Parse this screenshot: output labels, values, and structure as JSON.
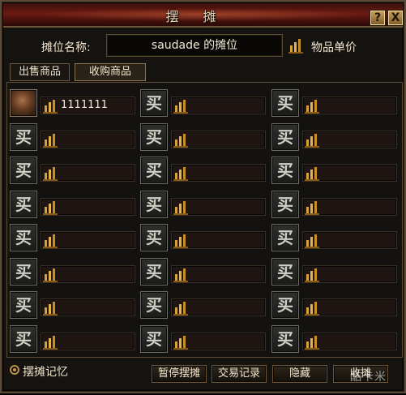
{
  "window": {
    "title": "摆摊",
    "help_symbol": "?",
    "close_symbol": "X"
  },
  "stall": {
    "name_label": "摊位名称:",
    "name_value": "saudade 的摊位",
    "unit_label": "物品单价",
    "unit_icon": "gold-bars-icon"
  },
  "tabs": [
    {
      "label": "出售商品",
      "active": false
    },
    {
      "label": "收购商品",
      "active": true
    }
  ],
  "slots": [
    {
      "icon": "item-icon",
      "price": "1111111"
    },
    {
      "icon": "buy-icon",
      "glyph": "买",
      "price": ""
    },
    {
      "icon": "buy-icon",
      "glyph": "买",
      "price": ""
    },
    {
      "icon": "buy-icon",
      "glyph": "买",
      "price": ""
    },
    {
      "icon": "buy-icon",
      "glyph": "买",
      "price": ""
    },
    {
      "icon": "buy-icon",
      "glyph": "买",
      "price": ""
    },
    {
      "icon": "buy-icon",
      "glyph": "买",
      "price": ""
    },
    {
      "icon": "buy-icon",
      "glyph": "买",
      "price": ""
    },
    {
      "icon": "buy-icon",
      "glyph": "买",
      "price": ""
    },
    {
      "icon": "buy-icon",
      "glyph": "买",
      "price": ""
    },
    {
      "icon": "buy-icon",
      "glyph": "买",
      "price": ""
    },
    {
      "icon": "buy-icon",
      "glyph": "买",
      "price": ""
    },
    {
      "icon": "buy-icon",
      "glyph": "买",
      "price": ""
    },
    {
      "icon": "buy-icon",
      "glyph": "买",
      "price": ""
    },
    {
      "icon": "buy-icon",
      "glyph": "买",
      "price": ""
    },
    {
      "icon": "buy-icon",
      "glyph": "买",
      "price": ""
    },
    {
      "icon": "buy-icon",
      "glyph": "买",
      "price": ""
    },
    {
      "icon": "buy-icon",
      "glyph": "买",
      "price": ""
    },
    {
      "icon": "buy-icon",
      "glyph": "买",
      "price": ""
    },
    {
      "icon": "buy-icon",
      "glyph": "买",
      "price": ""
    },
    {
      "icon": "buy-icon",
      "glyph": "买",
      "price": ""
    },
    {
      "icon": "buy-icon",
      "glyph": "买",
      "price": ""
    },
    {
      "icon": "buy-icon",
      "glyph": "买",
      "price": ""
    },
    {
      "icon": "buy-icon",
      "glyph": "买",
      "price": ""
    }
  ],
  "footer": {
    "memory_label": "摆摊记忆",
    "pause_label": "暂停摆摊",
    "log_label": "交易记录",
    "hide_label": "隐藏",
    "close_label": "收摊"
  },
  "watermark": "酷卡米",
  "colors": {
    "title_bar": "#6b1a12",
    "border": "#5a4a36",
    "text": "#efe4cc",
    "gold": "#d6a13a"
  }
}
